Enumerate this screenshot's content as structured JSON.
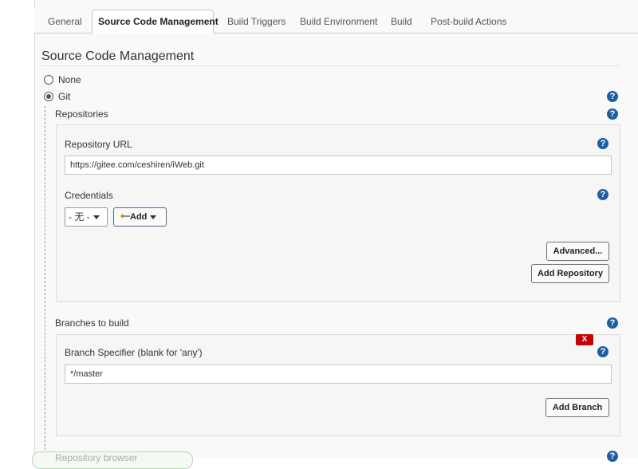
{
  "tabs": [
    {
      "label": "General"
    },
    {
      "label": "Source Code Management"
    },
    {
      "label": "Build Triggers"
    },
    {
      "label": "Build Environment"
    },
    {
      "label": "Build"
    },
    {
      "label": "Post-build Actions"
    }
  ],
  "scm": {
    "title": "Source Code Management",
    "options": [
      {
        "label": "None",
        "checked": false
      },
      {
        "label": "Git",
        "checked": true
      }
    ]
  },
  "repositories": {
    "label": "Repositories",
    "url_label": "Repository URL",
    "url_value": "https://gitee.com/ceshiren/iWeb.git",
    "credentials_label": "Credentials",
    "credentials_selected": "- 无 -",
    "add_label": "Add",
    "advanced_label": "Advanced...",
    "add_repo_label": "Add Repository"
  },
  "branches": {
    "label": "Branches to build",
    "delete_label": "X",
    "specifier_label": "Branch Specifier (blank for 'any')",
    "specifier_value": "*/master",
    "add_branch_label": "Add Branch"
  },
  "repo_browser": {
    "label": "Repository browser"
  },
  "help_glyph": "?",
  "colors": {
    "help": "#1f5fa0",
    "delete": "#cc0000",
    "panel": "#f9f9f9"
  }
}
